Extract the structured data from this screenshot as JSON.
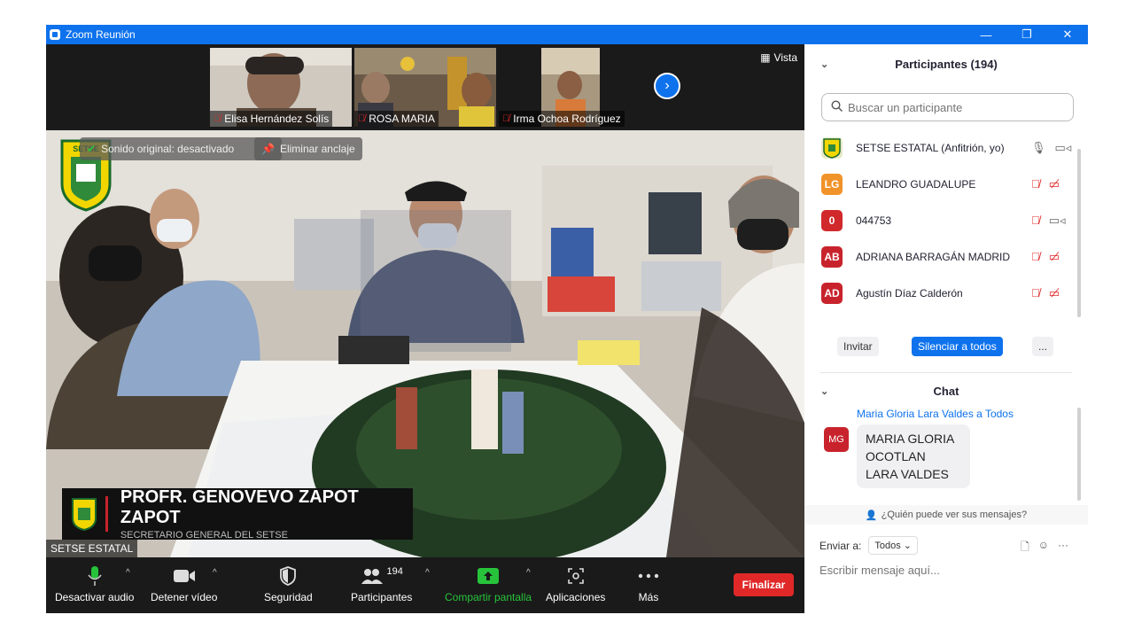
{
  "window": {
    "title": "Zoom Reunión",
    "controls": [
      "—",
      "❐",
      "✕"
    ]
  },
  "thumbnails": [
    {
      "name": "Elisa Hernández Solís"
    },
    {
      "name": "ROSA MARIA"
    },
    {
      "name": "Irma Ochoa Rodríguez"
    }
  ],
  "view_label": "Vista",
  "main_video": {
    "original_sound": "Sonido original: desactivado",
    "unpin": "Eliminar anclaje",
    "logo_text": "SETSE",
    "lower_third_name": "PROFR. GENOVEVO ZAPOT ZAPOT",
    "lower_third_role": "SECRETARIO GENERAL DEL SETSE",
    "speaker_label": "SETSE ESTATAL"
  },
  "toolbar": {
    "mute": "Desactivar audio",
    "video": "Detener vídeo",
    "security": "Seguridad",
    "participants": "Participantes",
    "participants_count": "194",
    "share": "Compartir pantalla",
    "apps": "Aplicaciones",
    "more": "Más",
    "end": "Finalizar"
  },
  "participants_panel": {
    "title": "Participantes (194)",
    "search_placeholder": "Buscar un participante",
    "list": [
      {
        "initials": "",
        "name": "SETSE ESTATAL (Anfitrión, yo)",
        "color": "#e9e9c8",
        "mic_muted": false,
        "video_off": false
      },
      {
        "initials": "LG",
        "name": " LEANDRO GUADALUPE",
        "color": "#f0932b",
        "mic_muted": true,
        "video_off": true
      },
      {
        "initials": "0",
        "name": "044753",
        "color": "#d1282b",
        "mic_muted": true,
        "video_off": false
      },
      {
        "initials": "AB",
        "name": "ADRIANA BARRAGÁN MADRID",
        "color": "#c8232c",
        "mic_muted": true,
        "video_off": true
      },
      {
        "initials": "AD",
        "name": "Agustín Díaz Calderón",
        "color": "#c8232c",
        "mic_muted": true,
        "video_off": true
      }
    ],
    "invite": "Invitar",
    "mute_all": "Silenciar a todos",
    "more": "..."
  },
  "chat_panel": {
    "title": "Chat",
    "message_from": "Maria Gloria Lara Valdes a Todos",
    "message_avatar": "MG",
    "message_text": "MARIA GLORIA OCOTLAN LARA VALDES",
    "who_can_see": "¿Quién puede ver sus mensajes?",
    "send_to_label": "Enviar a:",
    "send_to_value": "Todos",
    "input_placeholder": "Escribir mensaje aquí..."
  }
}
